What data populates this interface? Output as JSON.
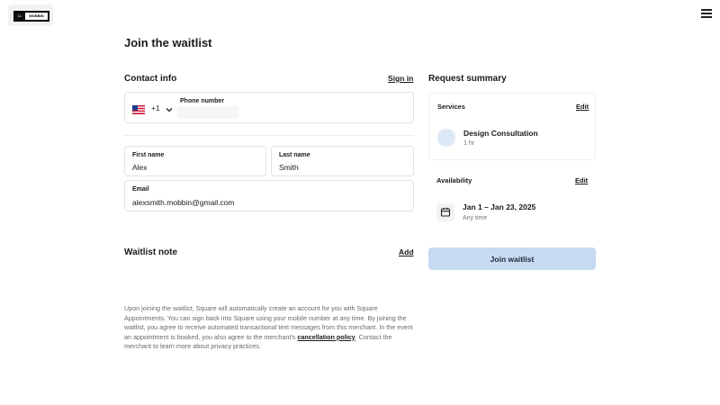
{
  "header": {
    "logo_left_text": "LL",
    "logo_right_text": "MOBBIN"
  },
  "page": {
    "title": "Join the waitlist"
  },
  "contact": {
    "title": "Contact info",
    "sign_in_label": "Sign in",
    "phone": {
      "country_code": "+1",
      "label": "Phone number",
      "value": ""
    },
    "first_name": {
      "label": "First name",
      "value": "Alex"
    },
    "last_name": {
      "label": "Last name",
      "value": "Smith"
    },
    "email": {
      "label": "Email",
      "value": "alexsmith.mobbin@gmail.com"
    }
  },
  "note": {
    "title": "Waitlist note",
    "add_label": "Add"
  },
  "legal": {
    "text_before": "Upon joining the waitlist, Square will automatically create an account for you with Square Appointments. You can sign back into Square using your mobile number at any time. By joining the waitlist, you agree to receive automated transactional text messages from this merchant. In the event an appointment is booked, you also agree to the merchant's ",
    "link_text": "cancellation policy",
    "text_after": ". Contact the merchant to learn more about privacy practices."
  },
  "summary": {
    "title": "Request summary",
    "services": {
      "title": "Services",
      "edit_label": "Edit",
      "item_name": "Design Consultation",
      "item_duration": "1 hr"
    },
    "availability": {
      "title": "Availability",
      "edit_label": "Edit",
      "dates": "Jan 1 – Jan 23, 2025",
      "time": "Any time"
    },
    "join_label": "Join waitlist"
  },
  "colors": {
    "accent_button": "#c6daf1",
    "avatar": "#dde8f6"
  },
  "icons": [
    "menu-icon",
    "us-flag-icon",
    "chevron-down-icon",
    "calendar-icon"
  ]
}
